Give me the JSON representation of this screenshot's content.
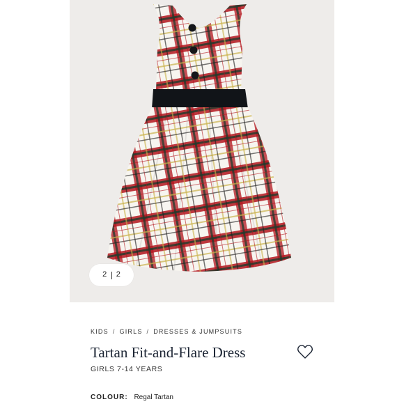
{
  "gallery": {
    "current": "2",
    "total": "2"
  },
  "breadcrumb": {
    "items": [
      "KIDS",
      "GIRLS",
      "DRESSES & JUMPSUITS"
    ],
    "separator": "/"
  },
  "product": {
    "title": "Tartan Fit-and-Flare Dress",
    "size_range": "GIRLS 7-14 YEARS",
    "colour_label": "COLOUR:",
    "colour_value": "Regal Tartan"
  },
  "colors": {
    "image_bg": "#eeecea",
    "title": "#1b2433",
    "tartan_red": "#b3161e",
    "tartan_green": "#1f3b2c",
    "sash": "#111418"
  },
  "icons": {
    "wishlist": "heart-outline-icon"
  }
}
